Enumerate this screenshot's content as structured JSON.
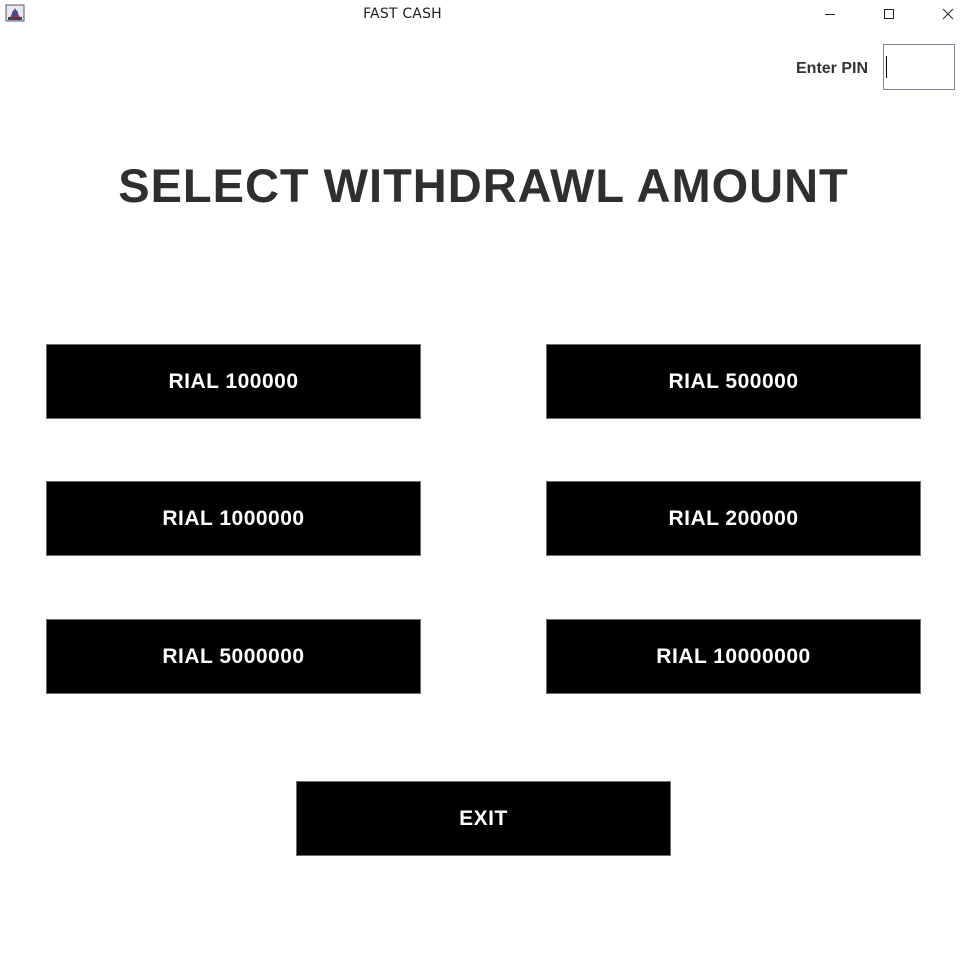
{
  "window": {
    "title": "FAST CASH",
    "controls": {
      "minimize": "minimize-icon",
      "maximize": "maximize-icon",
      "close": "close-icon"
    },
    "app_icon": "java-app-icon"
  },
  "pin": {
    "label": "Enter PIN",
    "value": ""
  },
  "heading": "SELECT WITHDRAWL AMOUNT",
  "amounts": [
    "RIAL 100000",
    "RIAL 500000",
    "RIAL 1000000",
    "RIAL 200000",
    "RIAL 5000000",
    "RIAL 10000000"
  ],
  "exit_label": "EXIT",
  "colors": {
    "button_bg": "#000000",
    "button_text": "#ffffff",
    "heading_text": "#2f2f2f",
    "window_bg": "#ffffff"
  }
}
